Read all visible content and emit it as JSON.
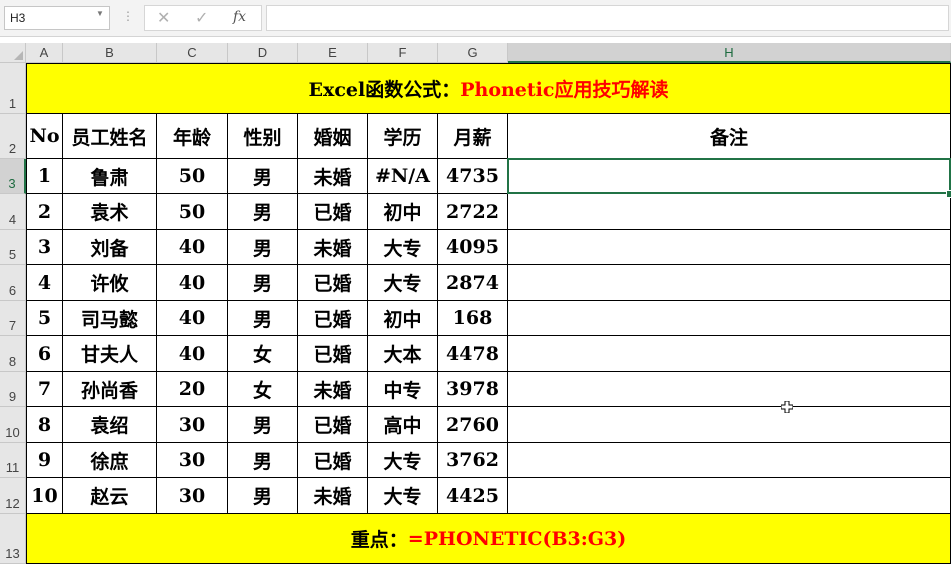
{
  "namebox": {
    "value": "H3"
  },
  "formula_bar": {
    "fx_label": "fx",
    "content": ""
  },
  "columns": [
    "A",
    "B",
    "C",
    "D",
    "E",
    "F",
    "G",
    "H"
  ],
  "row_numbers": [
    "1",
    "2",
    "3",
    "4",
    "5",
    "6",
    "7",
    "8",
    "9",
    "10",
    "11",
    "12",
    "13"
  ],
  "title": {
    "prefix": "Excel函数公式：",
    "highlight": "Phonetic应用技巧解读"
  },
  "headers": [
    "No",
    "员工姓名",
    "年龄",
    "性别",
    "婚姻",
    "学历",
    "月薪",
    "备注"
  ],
  "rows": [
    [
      "1",
      "鲁肃",
      "50",
      "男",
      "未婚",
      "#N/A",
      "4735",
      ""
    ],
    [
      "2",
      "袁术",
      "50",
      "男",
      "已婚",
      "初中",
      "2722",
      ""
    ],
    [
      "3",
      "刘备",
      "40",
      "男",
      "未婚",
      "大专",
      "4095",
      ""
    ],
    [
      "4",
      "许攸",
      "40",
      "男",
      "已婚",
      "大专",
      "2874",
      ""
    ],
    [
      "5",
      "司马懿",
      "40",
      "男",
      "已婚",
      "初中",
      "168",
      ""
    ],
    [
      "6",
      "甘夫人",
      "40",
      "女",
      "已婚",
      "大本",
      "4478",
      ""
    ],
    [
      "7",
      "孙尚香",
      "20",
      "女",
      "未婚",
      "中专",
      "3978",
      ""
    ],
    [
      "8",
      "袁绍",
      "30",
      "男",
      "已婚",
      "高中",
      "2760",
      ""
    ],
    [
      "9",
      "徐庶",
      "30",
      "男",
      "已婚",
      "大专",
      "3762",
      ""
    ],
    [
      "10",
      "赵云",
      "30",
      "男",
      "未婚",
      "大专",
      "4425",
      ""
    ]
  ],
  "footer": {
    "label": "重点：",
    "formula": "=PHONETIC(B3:G3)"
  },
  "selected_cell": "H3",
  "colors": {
    "band": "#ffff00",
    "accent_red": "#ff0000",
    "selection": "#217346"
  }
}
